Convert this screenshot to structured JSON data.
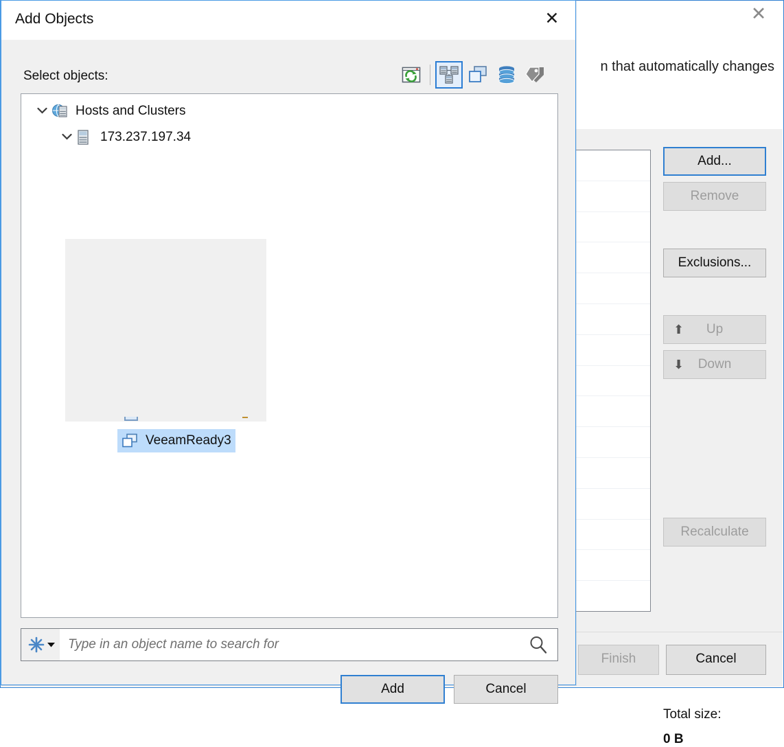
{
  "background_window": {
    "close_icon": "close-icon",
    "description_fragment": "n that automatically changes",
    "buttons": {
      "add": "Add...",
      "remove": "Remove",
      "exclusions": "Exclusions...",
      "up": "Up",
      "down": "Down",
      "recalculate": "Recalculate",
      "finish": "Finish",
      "cancel": "Cancel"
    },
    "total_size_label": "Total size:",
    "total_size_value": "0 B",
    "grid": {
      "rows": 15,
      "columns": 2
    },
    "icons": {
      "up_arrow": "arrow-up-icon",
      "down_arrow": "arrow-down-icon"
    },
    "colors": {
      "focus_border": "#2f7fd1",
      "disabled_text": "#9d9d9d",
      "panel_bg": "#f0f0f0"
    }
  },
  "modal": {
    "title": "Add Objects",
    "close_icon": "close-icon",
    "select_label": "Select objects:",
    "toolbar": [
      {
        "name": "refresh-icon",
        "label": "Refresh",
        "active": false
      },
      {
        "name": "hosts-and-clusters-icon",
        "label": "Hosts and Clusters",
        "active": true
      },
      {
        "name": "vms-and-templates-icon",
        "label": "VMs and Templates",
        "active": false
      },
      {
        "name": "datastores-icon",
        "label": "Datastores and VMs",
        "active": false
      },
      {
        "name": "tags-icon",
        "label": "Tags",
        "active": false
      }
    ],
    "tree": {
      "root": {
        "label": "Hosts and Clusters",
        "icon": "globe-server-icon",
        "expanded": true,
        "chevron": "⌄"
      },
      "host": {
        "label": "173.237.197.34",
        "icon": "host-icon",
        "expanded": true,
        "chevron": "⌄"
      },
      "selected": {
        "label": "VeeamReady3",
        "icon": "virtual-machine-icon",
        "selected": true
      }
    },
    "search": {
      "prefix_icon": "asterisk-filter-icon",
      "dropdown_icon": "chevron-down-icon",
      "placeholder": "Type in an object name to search for",
      "value": "",
      "go_icon": "search-icon"
    },
    "buttons": {
      "add": "Add",
      "cancel": "Cancel"
    },
    "colors": {
      "selection_bg": "#bddcfb",
      "focus_border": "#2f7fd1",
      "window_border": "#4a9ae4"
    }
  }
}
